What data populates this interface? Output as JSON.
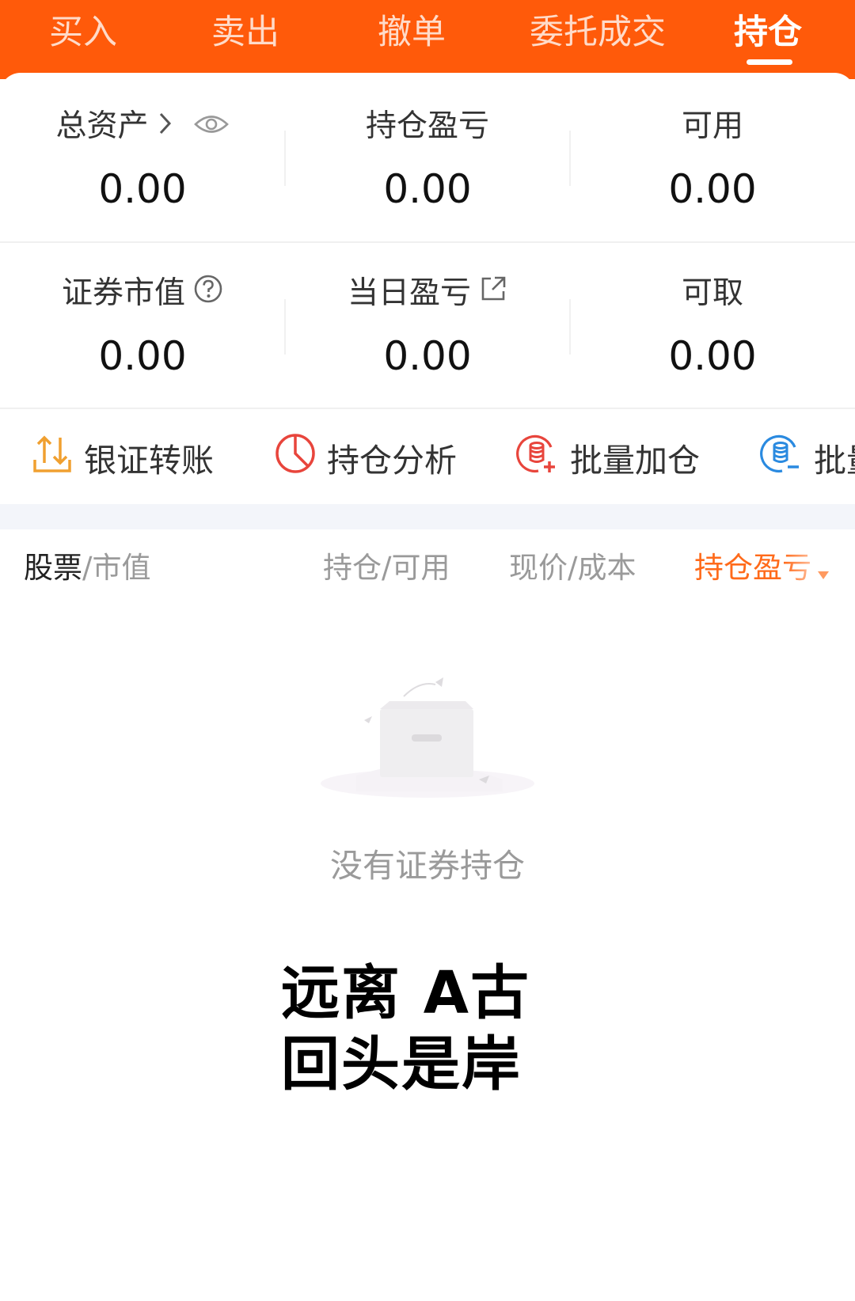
{
  "tabs": [
    {
      "label": "买入"
    },
    {
      "label": "卖出"
    },
    {
      "label": "撤单"
    },
    {
      "label": "委托成交"
    },
    {
      "label": "持仓"
    }
  ],
  "active_tab": "持仓",
  "summary": {
    "total_assets_label": "总资产",
    "total_assets_value": "0.00",
    "position_pnl_label": "持仓盈亏",
    "position_pnl_value": "0.00",
    "available_label": "可用",
    "available_value": "0.00",
    "market_value_label": "证券市值",
    "market_value_value": "0.00",
    "daily_pnl_label": "当日盈亏",
    "daily_pnl_value": "0.00",
    "withdrawable_label": "可取",
    "withdrawable_value": "0.00"
  },
  "shortcuts": [
    {
      "label": "银证转账",
      "icon": "transfer-icon"
    },
    {
      "label": "持仓分析",
      "icon": "pie-chart-icon"
    },
    {
      "label": "批量加仓",
      "icon": "batch-add-icon"
    },
    {
      "label": "批量",
      "icon": "batch-reduce-icon"
    }
  ],
  "columns": {
    "stock_strong": "股票",
    "stock_rest": "/市值",
    "position": "持仓/可用",
    "price": "现价/成本",
    "pnl": "持仓盈亏"
  },
  "empty_state": {
    "message": "没有证券持仓"
  },
  "slogan": {
    "line1": "远离 A古",
    "line2": "回头是岸"
  },
  "colors": {
    "brand": "#ff5a0a",
    "sorted_column": "#ff6a1a",
    "icon_orange": "#f0a030",
    "icon_red": "#e8453c",
    "icon_blue": "#2a8ae0"
  }
}
